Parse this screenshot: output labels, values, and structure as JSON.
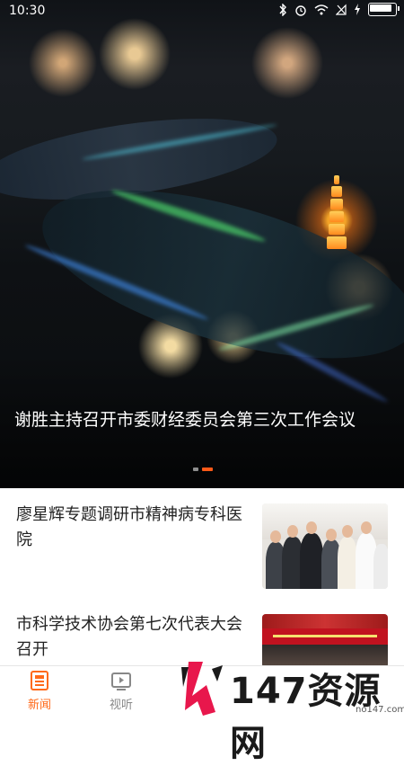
{
  "status_bar": {
    "time": "10:30"
  },
  "hero": {
    "title": "谢胜主持召开市委财经委员会第三次工作会议",
    "carousel_pages": 2,
    "carousel_active": 2
  },
  "news": [
    {
      "title": "廖星辉专题调研市精神病专科医院"
    },
    {
      "title": "市科学技术协会第七次代表大会召开"
    }
  ],
  "bottom_nav": {
    "items": [
      {
        "label": "新闻",
        "icon": "newspaper-icon",
        "active": true
      },
      {
        "label": "视听",
        "icon": "video-icon",
        "active": false
      }
    ]
  },
  "watermark": {
    "text": "147资源网",
    "url": "no147.com"
  },
  "colors": {
    "accent": "#ff6a1a",
    "inactive": "#888888"
  }
}
